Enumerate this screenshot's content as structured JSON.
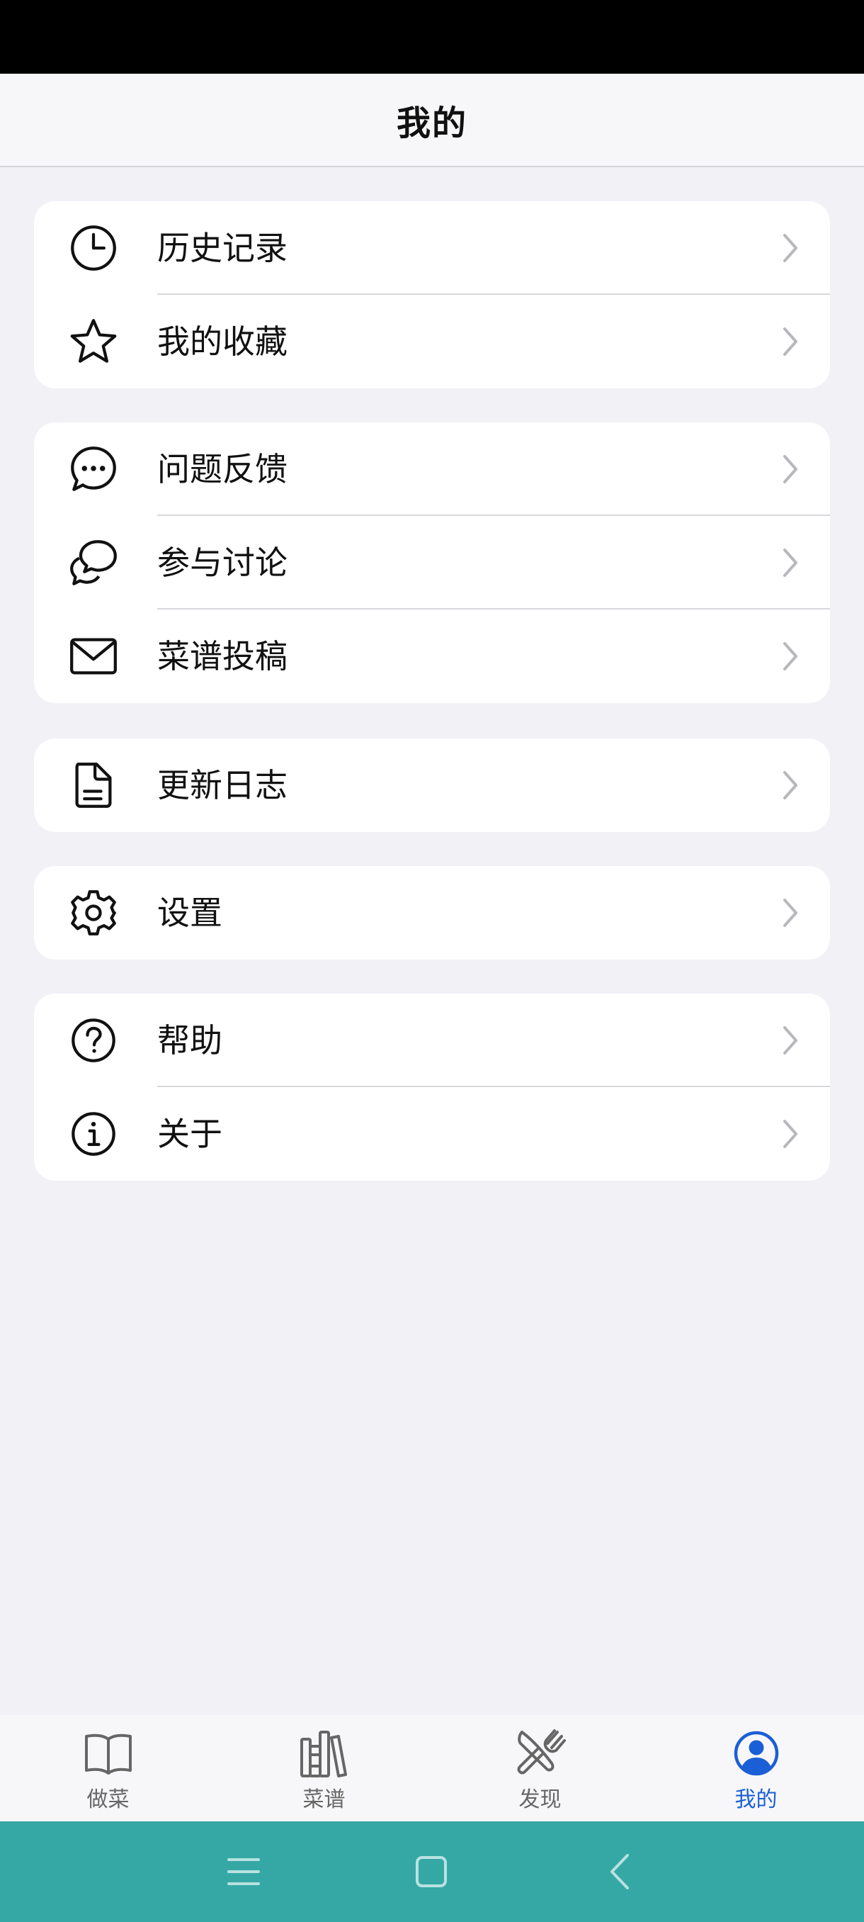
{
  "header": {
    "title": "我的"
  },
  "groups": [
    {
      "items": [
        {
          "label": "历史记录",
          "icon": "clock-icon"
        },
        {
          "label": "我的收藏",
          "icon": "star-icon"
        }
      ]
    },
    {
      "items": [
        {
          "label": "问题反馈",
          "icon": "chat-bubble-icon"
        },
        {
          "label": "参与讨论",
          "icon": "discussion-icon"
        },
        {
          "label": "菜谱投稿",
          "icon": "mail-icon"
        }
      ]
    },
    {
      "items": [
        {
          "label": "更新日志",
          "icon": "document-icon"
        }
      ]
    },
    {
      "items": [
        {
          "label": "设置",
          "icon": "gear-icon"
        }
      ]
    },
    {
      "items": [
        {
          "label": "帮助",
          "icon": "question-icon"
        },
        {
          "label": "关于",
          "icon": "info-icon"
        }
      ]
    }
  ],
  "tabs": [
    {
      "label": "做菜",
      "icon": "open-book-icon",
      "active": false
    },
    {
      "label": "菜谱",
      "icon": "books-icon",
      "active": false
    },
    {
      "label": "发现",
      "icon": "utensils-icon",
      "active": false
    },
    {
      "label": "我的",
      "icon": "person-icon",
      "active": true
    }
  ],
  "colors": {
    "active": "#1a5fd6",
    "inactive": "#666666",
    "nav_bar": "#35a8a6",
    "background": "#f1f1f6"
  }
}
